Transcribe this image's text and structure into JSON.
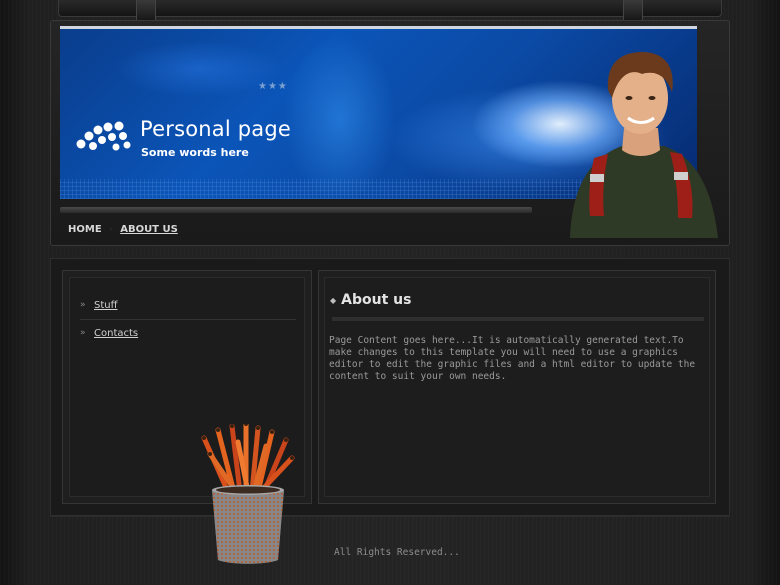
{
  "header": {
    "site_title": "Personal page",
    "site_subtitle": "Some words here",
    "stars": "★★★"
  },
  "nav": {
    "items": [
      {
        "label": "HOME",
        "active": false
      },
      {
        "label": "ABOUT US",
        "active": true
      }
    ],
    "separator": "·"
  },
  "sidebar": {
    "items": [
      {
        "label": "Stuff",
        "chevron": "»"
      },
      {
        "label": "Contacts",
        "chevron": "»"
      }
    ]
  },
  "main": {
    "bullet": "◆",
    "title": "About us",
    "body": "Page Content goes here...It is automatically generated text.To make changes to this template you will need to use a graphics editor to edit the graphic files and a html editor to update the content to suit your own needs."
  },
  "footer": {
    "copyright": "All Rights Reserved..."
  },
  "colors": {
    "background": "#1b1b1b",
    "banner_blue": "#0b55b8",
    "text_light": "#e4e4e4",
    "text_muted": "#9a9a9a"
  },
  "icons": {
    "logo": "dots-logo-icon",
    "nav_separator": "dot-separator-icon",
    "side_chevron": "double-chevron-right-icon",
    "title_bullet": "diamond-bullet-icon"
  }
}
